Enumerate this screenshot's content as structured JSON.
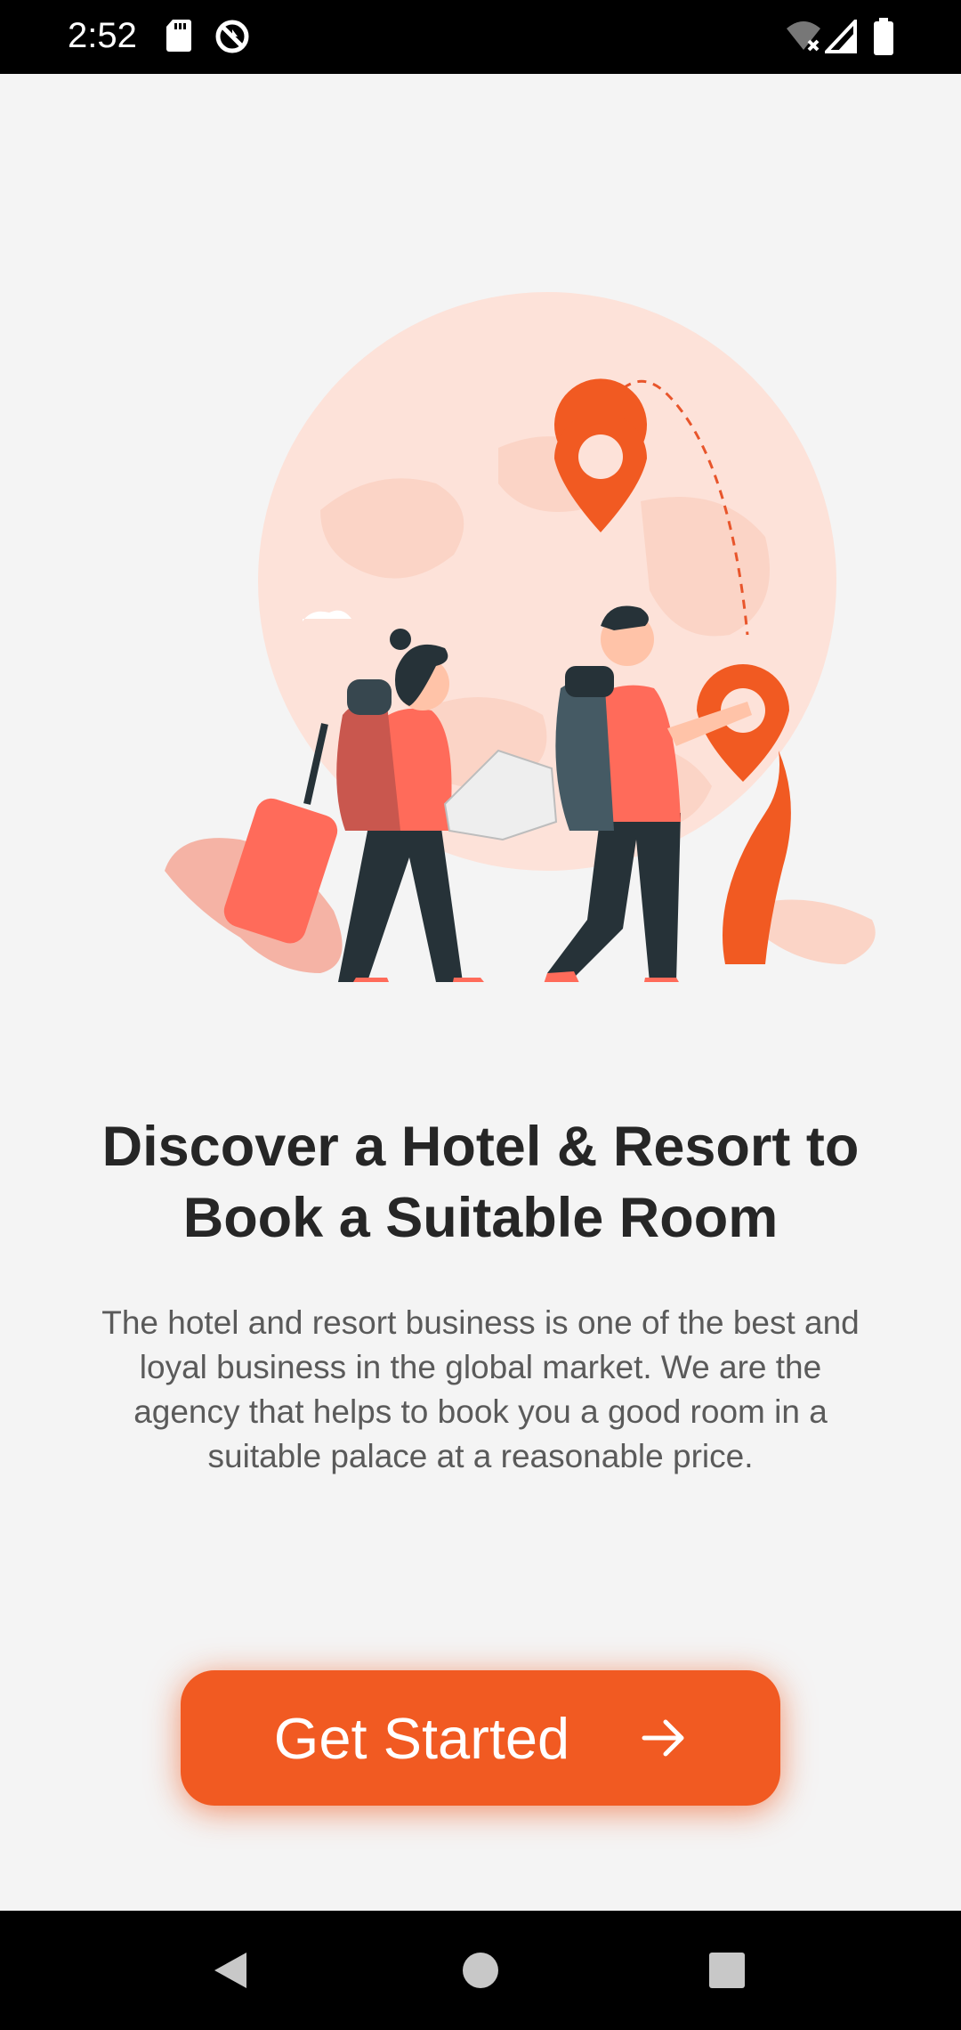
{
  "status_bar": {
    "time": "2:52",
    "icons": [
      "sd-card-icon",
      "sync-off-icon",
      "wifi-off-icon",
      "signal-icon",
      "battery-icon"
    ]
  },
  "onboarding": {
    "title": "Discover a Hotel & Resort to Book a Suitable Room",
    "description": "The hotel and resort business is one of the best and loyal business in the global market. We are the agency that helps to book you a good room in a suitable palace at a reasonable price.",
    "cta_label": "Get Started",
    "cta_icon": "arrow-right-icon"
  },
  "colors": {
    "accent": "#f15a22",
    "background": "#f4f4f4",
    "title": "#262626",
    "body_text": "#5a5a5a"
  },
  "nav_bar": {
    "buttons": [
      "back-icon",
      "home-icon",
      "recents-icon"
    ]
  }
}
